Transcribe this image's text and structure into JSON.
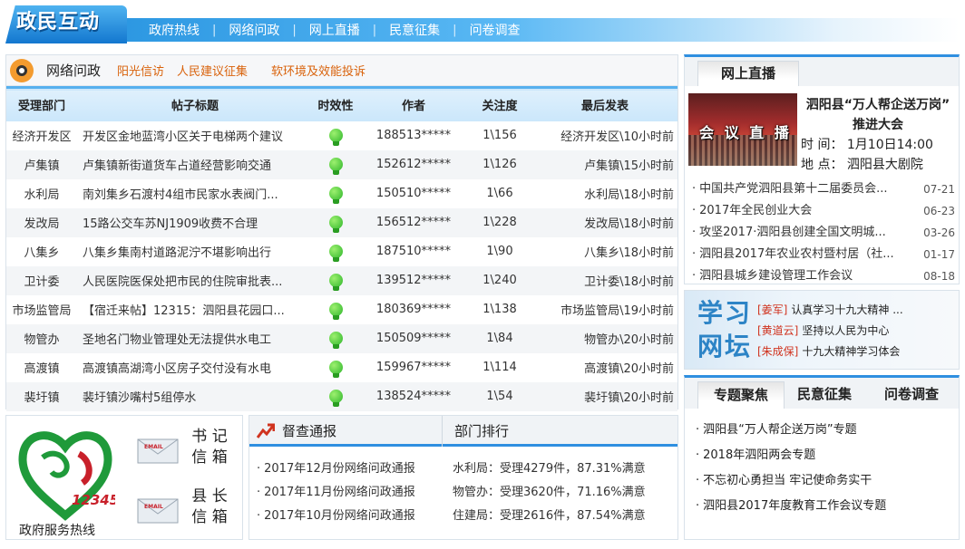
{
  "header": {
    "logo_text": "政民互动",
    "nav": [
      "政府热线",
      "网络问政",
      "网上直播",
      "民意征集",
      "问卷调查"
    ]
  },
  "section": {
    "title": "网络问政",
    "links": [
      "阳光信访",
      "人民建议征集",
      "软环境及效能投诉"
    ]
  },
  "table": {
    "columns": [
      "受理部门",
      "帖子标题",
      "时效性",
      "作者",
      "关注度",
      "最后发表"
    ],
    "rows": [
      {
        "dept": "经济开发区",
        "title": "开发区金地蓝湾小区关于电梯两个建议",
        "author": "188513*****",
        "follow": "1\\156",
        "last": "经济开发区\\10小时前"
      },
      {
        "dept": "卢集镇",
        "title": "卢集镇新街道货车占道经营影响交通",
        "author": "152612*****",
        "follow": "1\\126",
        "last": "卢集镇\\15小时前"
      },
      {
        "dept": "水利局",
        "title": "南刘集乡石渡村4组市民家水表阀门...",
        "author": "150510*****",
        "follow": "1\\66",
        "last": "水利局\\18小时前"
      },
      {
        "dept": "发改局",
        "title": "15路公交车苏NJ1909收费不合理",
        "author": "156512*****",
        "follow": "1\\228",
        "last": "发改局\\18小时前"
      },
      {
        "dept": "八集乡",
        "title": "八集乡集南村道路泥泞不堪影响出行",
        "author": "187510*****",
        "follow": "1\\90",
        "last": "八集乡\\18小时前"
      },
      {
        "dept": "卫计委",
        "title": "人民医院医保处把市民的住院审批表...",
        "author": "139512*****",
        "follow": "1\\240",
        "last": "卫计委\\18小时前"
      },
      {
        "dept": "市场监管局",
        "title": "【宿迁来帖】12315：泗阳县花园口...",
        "author": "180369*****",
        "follow": "1\\138",
        "last": "市场监管局\\19小时前"
      },
      {
        "dept": "物管办",
        "title": "圣地名门物业管理处无法提供水电工",
        "author": "150509*****",
        "follow": "1\\84",
        "last": "物管办\\20小时前"
      },
      {
        "dept": "高渡镇",
        "title": "高渡镇高湖湾小区房子交付没有水电",
        "author": "159967*****",
        "follow": "1\\114",
        "last": "高渡镇\\20小时前"
      },
      {
        "dept": "裴圩镇",
        "title": "裴圩镇沙嘴村5组停水",
        "author": "138524*****",
        "follow": "1\\54",
        "last": "裴圩镇\\20小时前"
      }
    ]
  },
  "hotline": {
    "emblem_number": "12345",
    "label": "政府服务热线",
    "mail_icon_text": "EMAIL",
    "mailbox1": [
      "书 记",
      "信 箱"
    ],
    "mailbox2": [
      "县 长",
      "信 箱"
    ]
  },
  "bulletin": {
    "title": "督查通报",
    "items": [
      "2017年12月份网络问政通报",
      "2017年11月份网络问政通报",
      "2017年10月份网络问政通报"
    ]
  },
  "ranking": {
    "title": "部门排行",
    "items": [
      "水利局：受理4279件，87.31%满意",
      "物管办：受理3620件，71.16%满意",
      "住建局：受理2616件，87.54%满意"
    ]
  },
  "live": {
    "tab": "网上直播",
    "photo_caption": "会 议 直 播",
    "title_line1": "泗阳县“万人帮企送万岗”",
    "title_line2": "推进大会",
    "time": "时 间： 1月10日14:00",
    "place": "地 点： 泗阳县大剧院",
    "items": [
      {
        "title": "中国共产党泗阳县第十二届委员会...",
        "date": "07-21"
      },
      {
        "title": "2017年全民创业大会",
        "date": "06-23"
      },
      {
        "title": "攻坚2017·泗阳县创建全国文明城...",
        "date": "03-26"
      },
      {
        "title": "泗阳县2017年农业农村暨村居（社...",
        "date": "01-17"
      },
      {
        "title": "泗阳县城乡建设管理工作会议",
        "date": "08-18"
      }
    ]
  },
  "forum": {
    "big_line1": "学习",
    "big_line2": "网坛",
    "items": [
      {
        "tag": "[姜军]",
        "text": "认真学习十九大精神 ..."
      },
      {
        "tag": "[黄道云]",
        "text": "坚持以人民为中心"
      },
      {
        "tag": "[朱成保]",
        "text": "十九大精神学习体会"
      }
    ]
  },
  "topics": {
    "tabs": [
      "专题聚焦",
      "民意征集",
      "问卷调查"
    ],
    "items": [
      "泗阳县“万人帮企送万岗”专题",
      "2018年泗阳两会专题",
      "不忘初心勇担当 牢记使命务实干",
      "泗阳县2017年度教育工作会议专题"
    ]
  },
  "colors": {
    "accent_blue": "#2f8fe0",
    "link_orange": "#d9620b",
    "status_green": "#2cb52a",
    "forum_tag_red": "#d0331f"
  }
}
